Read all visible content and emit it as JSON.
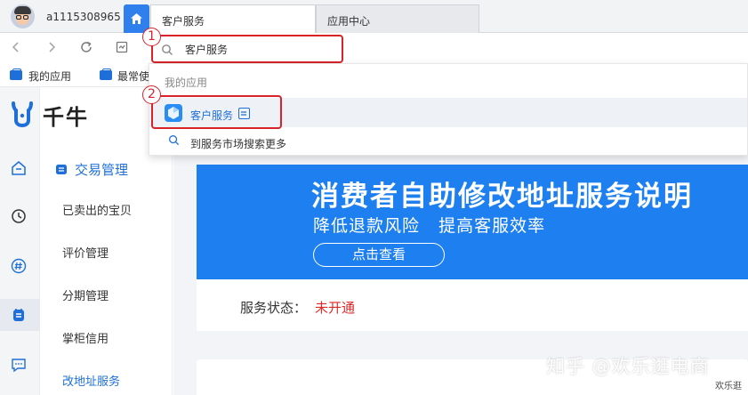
{
  "user": {
    "name": "a1115308965"
  },
  "tabs": [
    {
      "label": "客户服务"
    },
    {
      "label": "应用中心"
    }
  ],
  "address_bar": {
    "value": "客户服务"
  },
  "annotations": {
    "step1": "1",
    "step2": "2"
  },
  "bookmarks": [
    {
      "label": "我的应用"
    },
    {
      "label": "最常使"
    }
  ],
  "app": {
    "logo": "千牛"
  },
  "sidebar": {
    "section": "交易管理",
    "items": [
      {
        "label": "已卖出的宝贝"
      },
      {
        "label": "评价管理"
      },
      {
        "label": "分期管理"
      },
      {
        "label": "掌柜信用"
      },
      {
        "label": "改地址服务"
      }
    ]
  },
  "dropdown": {
    "header": "我的应用",
    "result": "客户服务",
    "search_more": "到服务市场搜索更多"
  },
  "banner": {
    "title": "消费者自助修改地址服务说明",
    "subtitle": "降低退款风险   提高客服效率",
    "button": "点击查看"
  },
  "service_status": {
    "label": "服务状态：",
    "value": "未开通"
  },
  "watermark": {
    "main": "知乎 @欢乐逛电商",
    "small": "欢乐逛"
  },
  "colors": {
    "accent": "#1e6fd9",
    "banner": "#1d7ff0",
    "annotation": "#d8232a",
    "status": "#e02a2a"
  }
}
